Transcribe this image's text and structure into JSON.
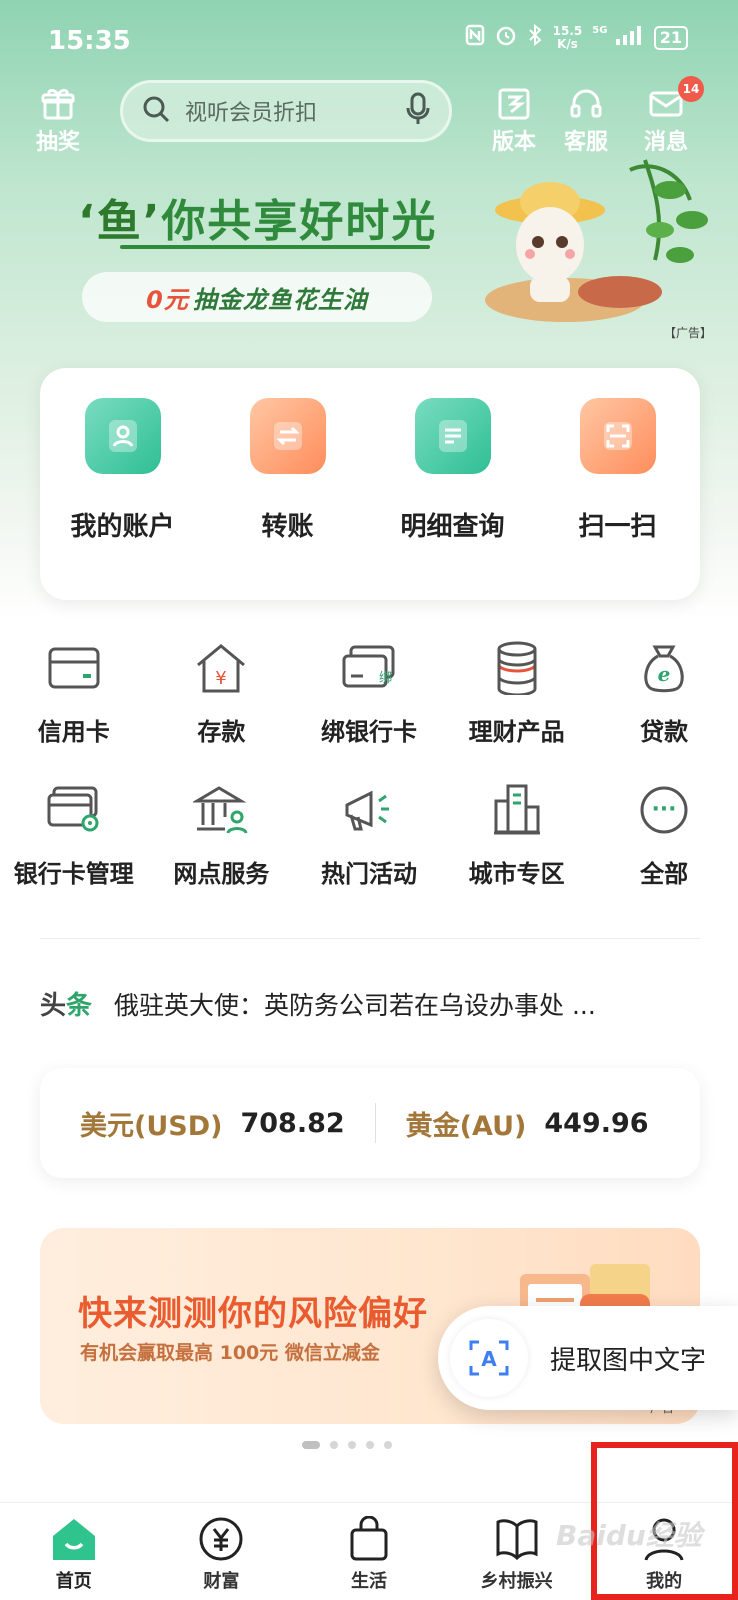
{
  "status_bar": {
    "time": "15:35",
    "speed_value": "15.5",
    "speed_unit": "K/s",
    "network": "5G",
    "battery": "21"
  },
  "header": {
    "lottery_label": "抽奖",
    "search_placeholder": "视听会员折扣",
    "version_label": "版本",
    "service_label": "客服",
    "message_label": "消息",
    "message_badge": "14"
  },
  "banner": {
    "title_brand": "‘鱼’",
    "title": "你共享好时光",
    "promo_red": "0元",
    "promo_text": "抽金龙鱼花生油",
    "ad_label": "【广告】"
  },
  "quick_actions": [
    {
      "label": "我的账户",
      "icon": "account-icon"
    },
    {
      "label": "转账",
      "icon": "transfer-icon"
    },
    {
      "label": "明细查询",
      "icon": "details-icon"
    },
    {
      "label": "扫一扫",
      "icon": "scan-icon"
    }
  ],
  "services": [
    {
      "label": "信用卡",
      "icon": "credit-card-icon"
    },
    {
      "label": "存款",
      "icon": "deposit-icon"
    },
    {
      "label": "绑银行卡",
      "icon": "bind-card-icon"
    },
    {
      "label": "理财产品",
      "icon": "wealth-products-icon"
    },
    {
      "label": "贷款",
      "icon": "loan-icon"
    },
    {
      "label": "银行卡管理",
      "icon": "card-management-icon"
    },
    {
      "label": "网点服务",
      "icon": "branch-service-icon"
    },
    {
      "label": "热门活动",
      "icon": "hot-activity-icon"
    },
    {
      "label": "城市专区",
      "icon": "city-zone-icon"
    },
    {
      "label": "全部",
      "icon": "all-icon"
    }
  ],
  "icon_texts": {
    "yen": "¥",
    "bind": "绑",
    "e": "e",
    "more": "···",
    "ocr": "A"
  },
  "headline": {
    "tag_a": "头",
    "tag_b": "条",
    "text": "俄驻英大使：英防务公司若在乌设办事处 ..."
  },
  "rates": [
    {
      "name": "美元(USD)",
      "value": "708.82"
    },
    {
      "name": "黄金(AU)",
      "value": "449.96"
    }
  ],
  "promo": {
    "title": "快来测测你的风险偏好",
    "subtitle": "有机会赢取最高 100元 微信立减金",
    "ad_label": "广告"
  },
  "ocr_popup": {
    "label": "提取图中文字"
  },
  "carousel": {
    "count": 5,
    "active": 1
  },
  "tabs": [
    {
      "label": "首页",
      "icon": "home-icon",
      "active": true
    },
    {
      "label": "财富",
      "icon": "wealth-icon",
      "active": false
    },
    {
      "label": "生活",
      "icon": "shopping-bag-icon",
      "active": false
    },
    {
      "label": "乡村振兴",
      "icon": "rural-book-icon",
      "active": false
    },
    {
      "label": "我的",
      "icon": "profile-icon",
      "active": false
    }
  ],
  "watermark": "Baidu经验",
  "colors": {
    "brand_green": "#2fa56c",
    "accent_orange": "#ff8d5c",
    "highlight_red": "#e8221d"
  }
}
